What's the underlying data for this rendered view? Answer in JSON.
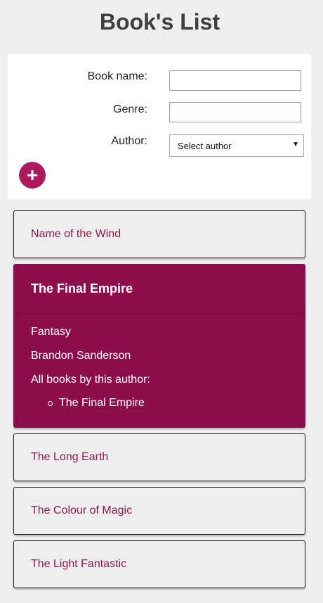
{
  "page": {
    "title": "Book's List"
  },
  "form": {
    "book_name_label": "Book name:",
    "genre_label": "Genre:",
    "author_label": "Author:",
    "author_select_value": "Select author",
    "book_name_value": "",
    "genre_value": "",
    "add_button_label": "+"
  },
  "books": [
    {
      "name": "Name of the Wind"
    },
    {
      "name": "The Final Empire",
      "expanded": true,
      "genre": "Fantasy",
      "author": "Brandon Sanderson",
      "all_books_label": "All books by this author:",
      "author_books": [
        "The Final Empire"
      ]
    },
    {
      "name": "The Long Earth"
    },
    {
      "name": "The Colour of Magic"
    },
    {
      "name": "The Light Fantastic"
    }
  ],
  "colors": {
    "accent": "#8b0d4c",
    "add_button": "#aa1a5c",
    "link_text": "#8c1a4e",
    "background": "#eeeeee"
  },
  "icons": {
    "add": "plus-icon",
    "select_arrow": "caret-down-icon"
  }
}
